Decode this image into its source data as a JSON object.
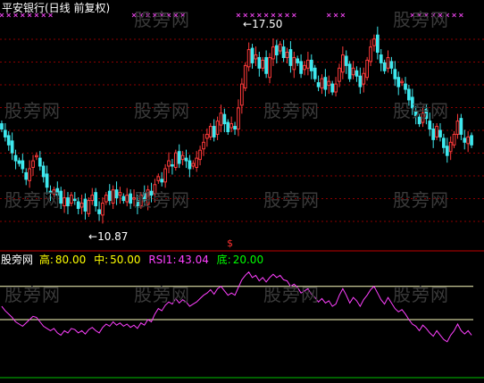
{
  "title": "平安银行(日线 前复权)",
  "watermark": "股旁网",
  "price_high_label": "17.50",
  "price_low_label": "10.87",
  "arrow": "←",
  "signal_mark": "$",
  "indicator": {
    "name": "股旁网",
    "items": [
      {
        "label": "高:",
        "value": "80.00",
        "color": "#ffff00"
      },
      {
        "label": "中:",
        "value": "50.00",
        "color": "#ffff00"
      },
      {
        "label": "RSI1:",
        "value": "43.04",
        "color": "#ff40ff"
      },
      {
        "label": "底:",
        "value": "20.00",
        "color": "#00ff00"
      }
    ]
  },
  "colors": {
    "up": "#ff3a3a",
    "down": "#3ee8ee",
    "grid": "#8b0000",
    "rsi": "#ff40ff",
    "level_line": "#ffffc0",
    "cross": "#e040e0"
  },
  "chart_data": [
    {
      "type": "candlestick",
      "title": "平安银行(日线 前复权)",
      "annotations": [
        "17.50",
        "10.87"
      ],
      "ylim": [
        9.8,
        18.3
      ],
      "close": [
        14.1,
        13.8,
        13.5,
        13.2,
        12.9,
        12.8,
        12.6,
        12.2,
        12.6,
        12.9,
        13.1,
        12.7,
        12.3,
        11.9,
        11.7,
        11.8,
        11.6,
        11.3,
        11.5,
        11.2,
        11.6,
        11.4,
        11.1,
        11.3,
        11.0,
        11.4,
        11.6,
        11.2,
        10.9,
        11.3,
        11.6,
        11.4,
        11.8,
        11.5,
        11.7,
        11.4,
        11.6,
        11.3,
        11.5,
        11.2,
        11.6,
        11.4,
        11.8,
        11.6,
        12.0,
        12.3,
        12.1,
        12.6,
        12.9,
        12.7,
        13.2,
        12.8,
        13.1,
        12.9,
        12.6,
        12.8,
        13.0,
        13.3,
        13.6,
        13.9,
        14.2,
        13.8,
        14.4,
        14.7,
        14.3,
        14.0,
        14.3,
        14.1,
        14.9,
        15.8,
        16.5,
        17.1,
        16.6,
        16.9,
        16.4,
        16.7,
        16.2,
        16.8,
        17.2,
        16.9,
        17.3,
        16.8,
        17.0,
        16.5,
        16.8,
        16.6,
        16.2,
        16.5,
        16.7,
        16.3,
        16.0,
        15.7,
        16.0,
        15.6,
        15.9,
        15.5,
        15.8,
        16.4,
        16.9,
        16.5,
        16.0,
        16.4,
        16.1,
        15.7,
        16.2,
        16.7,
        17.2,
        17.5,
        17.0,
        16.6,
        16.3,
        16.8,
        16.4,
        16.0,
        15.7,
        15.9,
        15.6,
        15.2,
        14.9,
        14.6,
        14.3,
        14.7,
        14.5,
        14.1,
        13.7,
        14.2,
        13.8,
        13.4,
        13.1,
        13.6,
        13.9,
        14.4,
        13.9,
        13.6,
        13.8,
        13.5
      ]
    },
    {
      "type": "line",
      "title": "RSI1",
      "ylim": [
        0,
        100
      ],
      "levels": [
        80,
        50,
        20
      ],
      "values": [
        62,
        58,
        55,
        52,
        48,
        46,
        44,
        47,
        50,
        53,
        52,
        48,
        44,
        42,
        40,
        42,
        38,
        36,
        40,
        38,
        42,
        41,
        38,
        40,
        37,
        41,
        43,
        40,
        38,
        43,
        46,
        44,
        48,
        45,
        47,
        44,
        46,
        43,
        45,
        42,
        47,
        45,
        50,
        48,
        55,
        60,
        58,
        63,
        66,
        64,
        69,
        65,
        68,
        66,
        62,
        64,
        66,
        69,
        72,
        74,
        77,
        73,
        78,
        80,
        76,
        72,
        74,
        72,
        79,
        86,
        90,
        93,
        88,
        90,
        85,
        88,
        84,
        88,
        91,
        88,
        90,
        86,
        85,
        80,
        82,
        79,
        74,
        76,
        78,
        73,
        70,
        66,
        69,
        65,
        67,
        62,
        64,
        72,
        78,
        72,
        65,
        70,
        67,
        62,
        68,
        72,
        77,
        80,
        74,
        68,
        64,
        70,
        65,
        60,
        57,
        59,
        55,
        50,
        46,
        44,
        40,
        45,
        42,
        38,
        35,
        40,
        36,
        32,
        30,
        36,
        40,
        46,
        40,
        37,
        40,
        36
      ]
    }
  ]
}
